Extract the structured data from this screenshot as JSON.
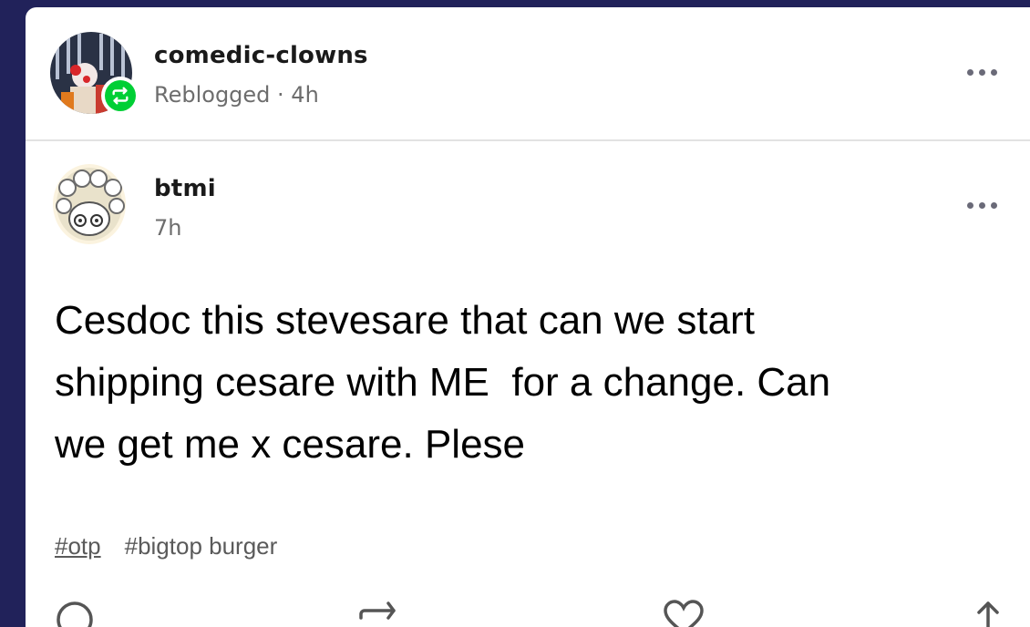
{
  "reblog": {
    "username": "comedic-clowns",
    "status": "Reblogged · 4h"
  },
  "post": {
    "username": "btmi",
    "time": "7h",
    "body": "Cesdoc this stevesare that can we start\nshipping cesare with ME  for a change. Can\nwe get me x cesare. Plese",
    "tags": [
      "#otp",
      "#bigtop burger"
    ]
  },
  "icons": {
    "reblog_menu": "more-horizontal-icon",
    "post_menu": "more-horizontal-icon",
    "badge": "reblog-icon",
    "footer": [
      "comment-icon",
      "reblog-icon",
      "heart-icon",
      "share-icon"
    ]
  },
  "colors": {
    "background": "#21225a",
    "badge_green": "#00cf35",
    "meta_gray": "#6d6d6d"
  }
}
